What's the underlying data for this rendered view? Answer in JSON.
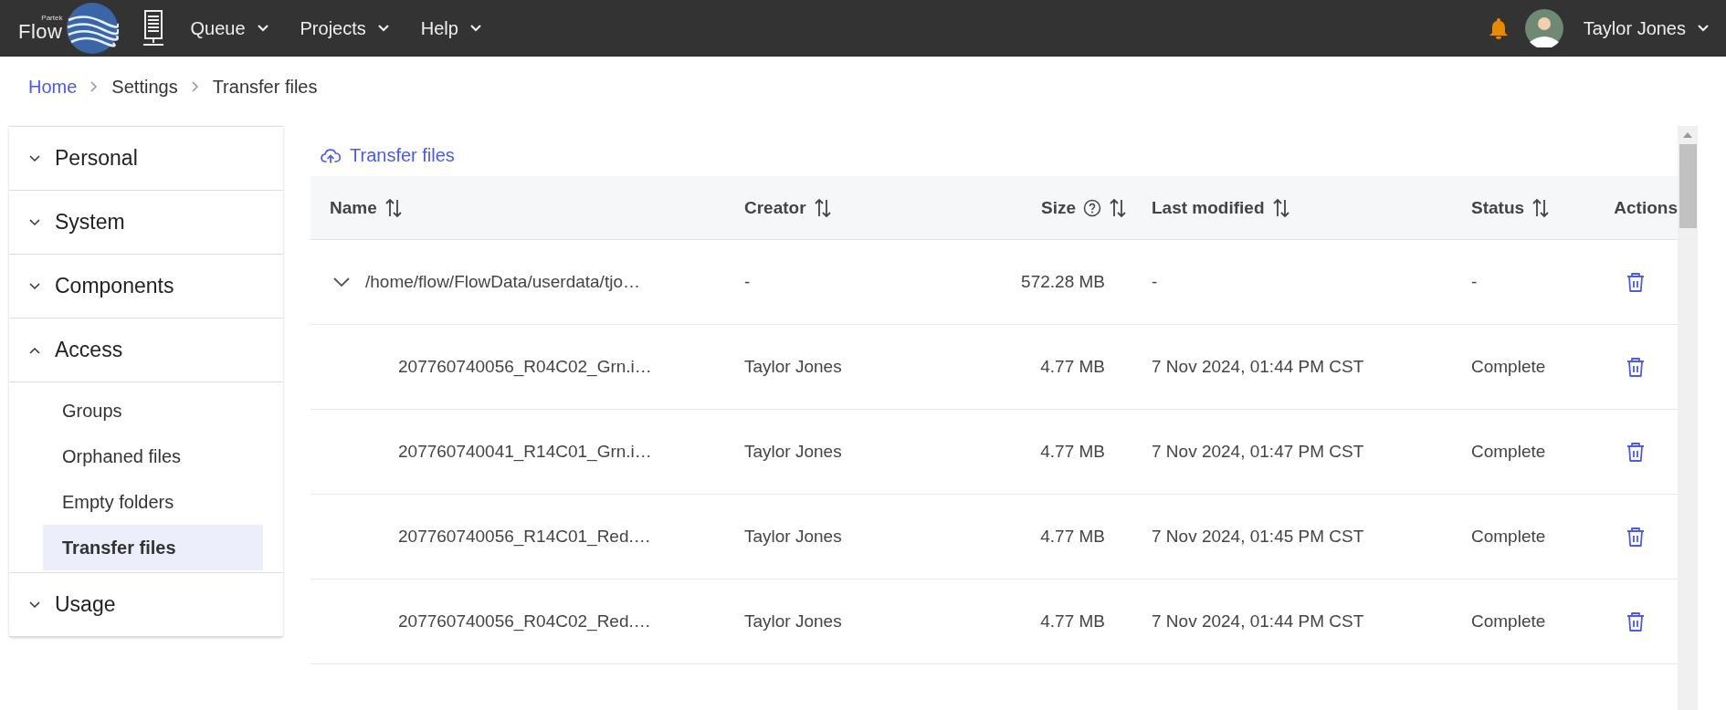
{
  "header": {
    "logo": {
      "small_text": "Partek",
      "text": "Flow"
    },
    "menus": [
      {
        "label": "Queue"
      },
      {
        "label": "Projects"
      },
      {
        "label": "Help"
      }
    ],
    "user": {
      "name": "Taylor Jones"
    }
  },
  "breadcrumb": [
    {
      "label": "Home",
      "link": true
    },
    {
      "label": "Settings",
      "link": false
    },
    {
      "label": "Transfer files",
      "link": false
    }
  ],
  "sidebar": {
    "sections": [
      {
        "label": "Personal",
        "expanded": false
      },
      {
        "label": "System",
        "expanded": false
      },
      {
        "label": "Components",
        "expanded": false
      },
      {
        "label": "Access",
        "expanded": true,
        "items": [
          {
            "label": "Groups",
            "selected": false
          },
          {
            "label": "Orphaned files",
            "selected": false
          },
          {
            "label": "Empty folders",
            "selected": false
          },
          {
            "label": "Transfer files",
            "selected": true
          }
        ]
      },
      {
        "label": "Usage",
        "expanded": false
      }
    ]
  },
  "transfer_link": "Transfer files",
  "table": {
    "columns": [
      {
        "label": "Name",
        "sortable": true,
        "help": false
      },
      {
        "label": "Creator",
        "sortable": true,
        "help": false
      },
      {
        "label": "Size",
        "sortable": true,
        "help": true
      },
      {
        "label": "Last modified",
        "sortable": true,
        "help": false
      },
      {
        "label": "Status",
        "sortable": true,
        "help": false
      },
      {
        "label": "Actions",
        "sortable": false,
        "help": false
      }
    ],
    "rows": [
      {
        "name": "/home/flow/FlowData/userdata/tjo…",
        "creator": "-",
        "size": "572.28 MB",
        "modified": "-",
        "status": "-",
        "expanded": true,
        "children": [
          {
            "name": "207760740056_R04C02_Grn.i…",
            "creator": "Taylor Jones",
            "size": "4.77 MB",
            "modified": "7 Nov 2024, 01:44 PM CST",
            "status": "Complete"
          },
          {
            "name": "207760740041_R14C01_Grn.i…",
            "creator": "Taylor Jones",
            "size": "4.77 MB",
            "modified": "7 Nov 2024, 01:47 PM CST",
            "status": "Complete"
          },
          {
            "name": "207760740056_R14C01_Red.…",
            "creator": "Taylor Jones",
            "size": "4.77 MB",
            "modified": "7 Nov 2024, 01:45 PM CST",
            "status": "Complete"
          },
          {
            "name": "207760740056_R04C02_Red.…",
            "creator": "Taylor Jones",
            "size": "4.77 MB",
            "modified": "7 Nov 2024, 01:44 PM CST",
            "status": "Complete"
          }
        ]
      }
    ]
  }
}
